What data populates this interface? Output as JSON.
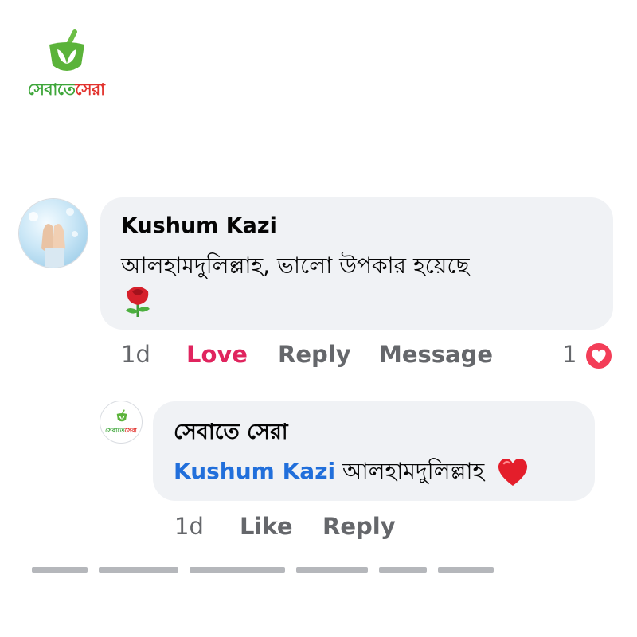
{
  "logo": {
    "text_green": "সেবাতে",
    "text_red": "সেরা"
  },
  "comment": {
    "author": "Kushum Kazi",
    "text": "আলহামদুলিল্লাহ, ভালো উপকার হয়েছে",
    "emoji": "rose-icon",
    "time": "1d",
    "love_label": "Love",
    "reply_label": "Reply",
    "message_label": "Message",
    "reaction_count": "1",
    "reaction_icon": "heart-reaction-icon"
  },
  "reply": {
    "author": "সেবাতে সেরা",
    "mention": "Kushum Kazi",
    "text": "আলহামদুলিল্লাহ",
    "emoji": "red-heart-icon",
    "time": "1d",
    "like_label": "Like",
    "reply_label": "Reply"
  },
  "colors": {
    "bubble": "#f0f2f5",
    "mention": "#216fdb",
    "love": "#e0245e",
    "muted": "#65676b",
    "brand_green": "#3ea63a",
    "brand_red": "#e2322d"
  }
}
